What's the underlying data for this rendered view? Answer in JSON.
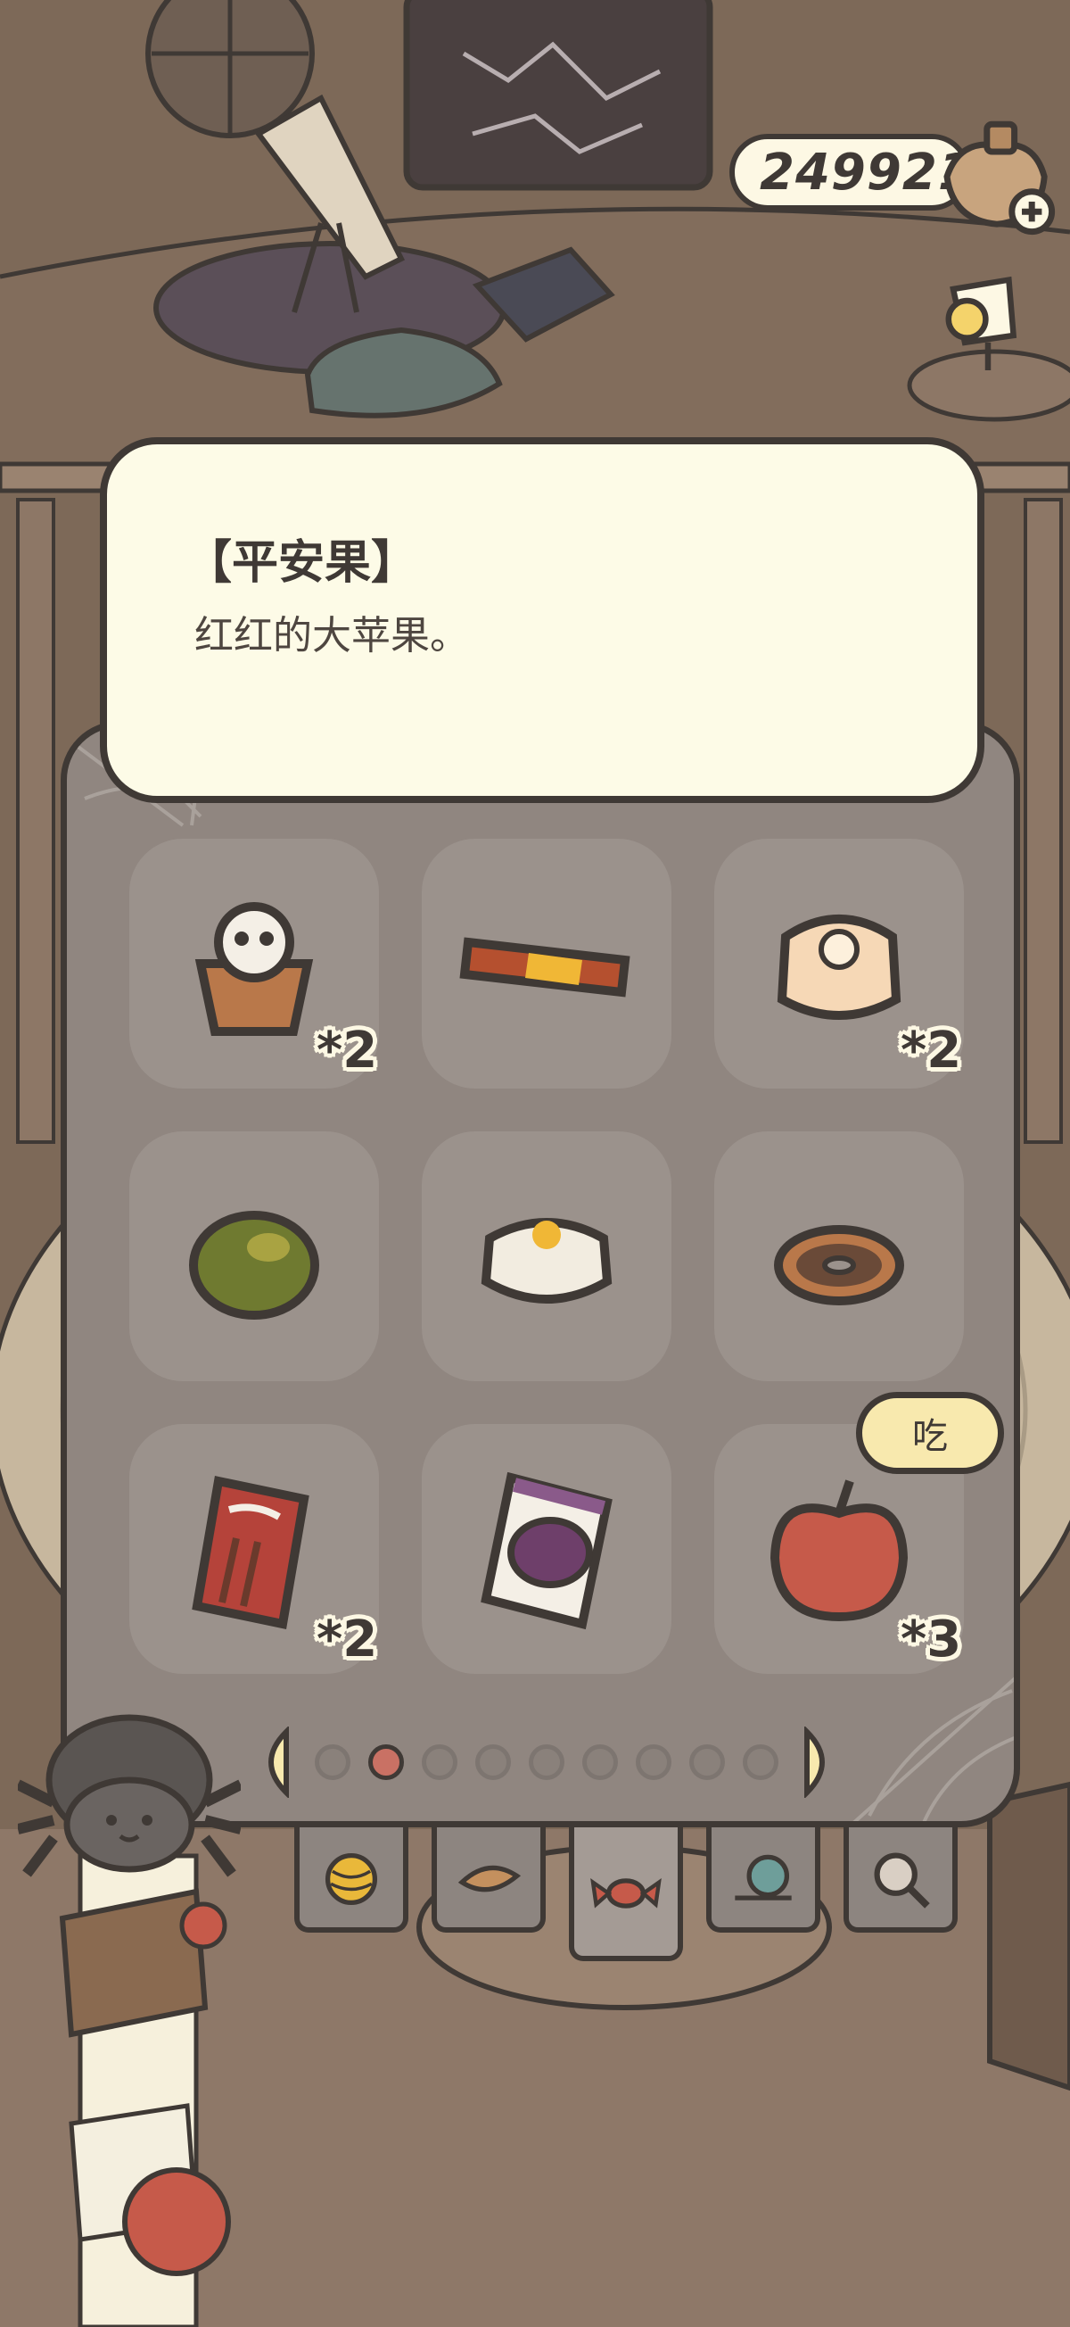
{
  "currency": {
    "amount": "249921"
  },
  "item_detail": {
    "title": "【平安果】",
    "description": "红红的大苹果。"
  },
  "inventory": {
    "slots": [
      {
        "name": "skull-cupcake",
        "icon": "skull-cupcake-icon",
        "count": "*2"
      },
      {
        "name": "chocolate-bar",
        "icon": "candy-bar-icon",
        "count": ""
      },
      {
        "name": "mooncake-white",
        "icon": "mooncake-icon",
        "count": "*2"
      },
      {
        "name": "green-orange",
        "icon": "citrus-icon",
        "count": ""
      },
      {
        "name": "rice-cake",
        "icon": "rice-cake-icon",
        "count": ""
      },
      {
        "name": "donut",
        "icon": "donut-icon",
        "count": ""
      },
      {
        "name": "pocky-box",
        "icon": "pocky-box-icon",
        "count": "*2"
      },
      {
        "name": "grape-candy-bag",
        "icon": "snack-bag-icon",
        "count": ""
      },
      {
        "name": "red-apple",
        "icon": "apple-icon",
        "count": "*3"
      }
    ],
    "eat_label": "吃",
    "pages": 9,
    "current_page": 1
  },
  "tabs": [
    {
      "icon": "yarn-ball-icon",
      "active": false
    },
    {
      "icon": "leaf-icon",
      "active": false
    },
    {
      "icon": "candy-icon",
      "active": true
    },
    {
      "icon": "snail-icon",
      "active": false
    },
    {
      "icon": "magnifier-icon",
      "active": false
    }
  ],
  "colors": {
    "background": "#7d6958",
    "panel": "#908680",
    "card": "#fdfbe7",
    "outline": "#3f3935",
    "eat_button": "#f8e9ae",
    "active_dot": "#c97164"
  }
}
